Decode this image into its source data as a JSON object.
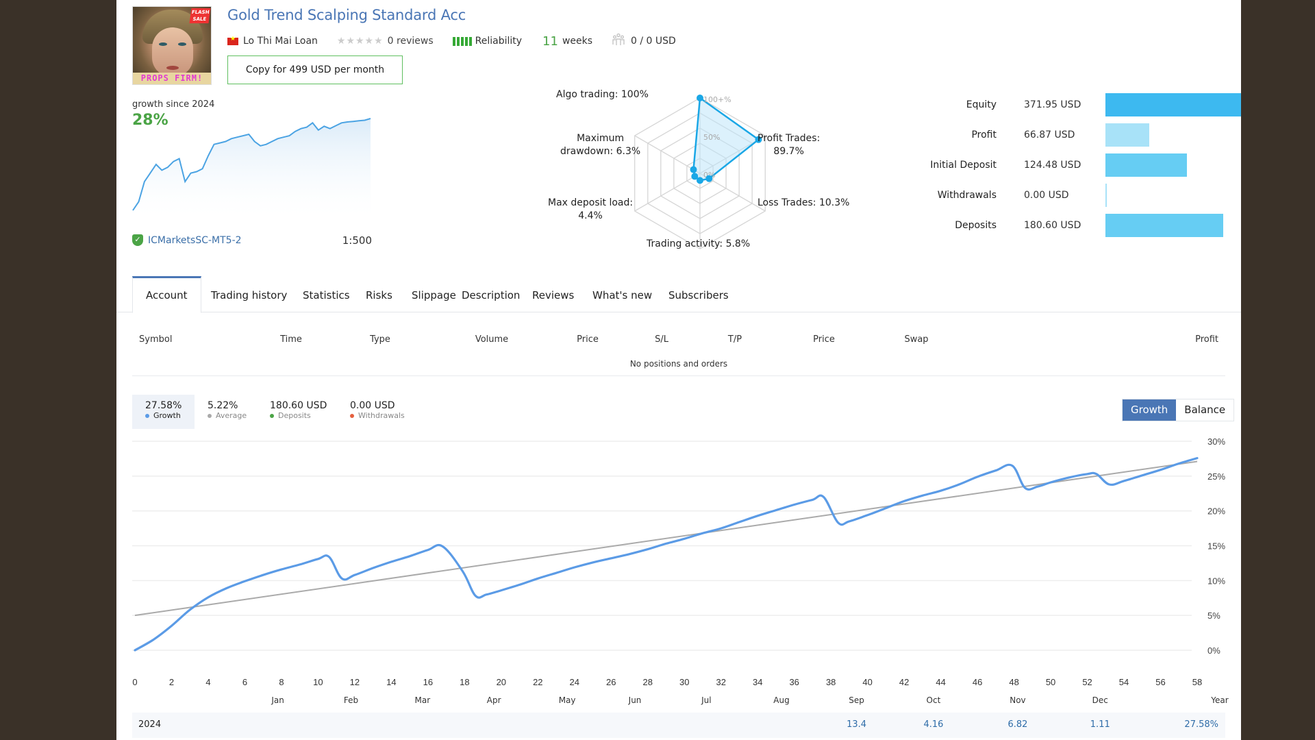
{
  "header": {
    "title": "Gold Trend Scalping Standard Acc",
    "avatar": {
      "banner_text": "PROPS FIRM!",
      "badge_text": "FLASH SALE"
    },
    "author": "Lo Thi Mai Loan",
    "author_flag_icon": "vietnam-flag-icon",
    "rating_stars": 0,
    "reviews": "0 reviews",
    "reliability_label": "Reliability",
    "reliability_bars": 5,
    "weeks_number": "11",
    "weeks_label": "weeks",
    "subscribers": "0 / 0 USD",
    "copy_button": "Copy for 499 USD per month"
  },
  "mini_growth": {
    "label": "growth since 2024",
    "value": "28%",
    "broker": "ICMarketsSC-MT5-2",
    "leverage": "1:500",
    "points": [
      0,
      3,
      10,
      13,
      16,
      14,
      15,
      17,
      18,
      10,
      13,
      13.5,
      14.5,
      19,
      23,
      23.5,
      24,
      25,
      25.5,
      26,
      26.5,
      24,
      22.5,
      23,
      24,
      25,
      25.5,
      26,
      27.5,
      28.5,
      29,
      30.5,
      28,
      29.3,
      28.5,
      29.5,
      30.5,
      30.8,
      31,
      31.2,
      31.4,
      32
    ]
  },
  "radar": {
    "axis_labels": [
      "100+%",
      "50%",
      "0%"
    ],
    "axes": [
      {
        "label": "Algo trading: 100%",
        "value": 100
      },
      {
        "label": "Profit Trades: 89.7%",
        "label_lines": [
          "Profit Trades:",
          "89.7%"
        ],
        "value": 89.7
      },
      {
        "label": "Loss Trades: 10.3%",
        "value": 10.3
      },
      {
        "label": "Trading activity: 5.8%",
        "value": 5.8
      },
      {
        "label": "Max deposit load: 4.4%",
        "label_lines": [
          "Max deposit load:",
          "4.4%"
        ],
        "value": 4.4
      },
      {
        "label": "Maximum drawdown: 6.3%",
        "label_lines": [
          "Maximum",
          "drawdown: 6.3%"
        ],
        "value": 6.3
      }
    ]
  },
  "financials": [
    {
      "label": "Equity",
      "value": "371.95 USD",
      "amount": 371.95,
      "color": "#3db9f0"
    },
    {
      "label": "Profit",
      "value": "66.87 USD",
      "amount": 66.87,
      "color": "#a8e2f8"
    },
    {
      "label": "Initial Deposit",
      "value": "124.48 USD",
      "amount": 124.48,
      "color": "#66cdf3"
    },
    {
      "label": "Withdrawals",
      "value": "0.00 USD",
      "amount": 0,
      "color": "#a8e2f8"
    },
    {
      "label": "Deposits",
      "value": "180.60 USD",
      "amount": 180.6,
      "color": "#66cdf3"
    }
  ],
  "tabs": [
    {
      "label": "Account",
      "active": true
    },
    {
      "label": "Trading history"
    },
    {
      "label": "Statistics"
    },
    {
      "label": "Risks"
    },
    {
      "label": "Slippage"
    },
    {
      "label": "Description"
    },
    {
      "label": "Reviews"
    },
    {
      "label": "What's new"
    },
    {
      "label": "Subscribers"
    }
  ],
  "positions": {
    "columns": [
      "Symbol",
      "Time",
      "Type",
      "Volume",
      "Price",
      "S/L",
      "T/P",
      "Price",
      "Swap",
      "Profit"
    ],
    "empty_text": "No positions and orders"
  },
  "summary": [
    {
      "value": "27.58%",
      "label": "Growth",
      "dot": "#5b9be6",
      "active": true
    },
    {
      "value": "5.22%",
      "label": "Average",
      "dot": "#aaaaaa"
    },
    {
      "value": "180.60 USD",
      "label": "Deposits",
      "dot": "#4ba446"
    },
    {
      "value": "0.00 USD",
      "label": "Withdrawals",
      "dot": "#e5603f"
    }
  ],
  "chart_toggle": {
    "growth": "Growth",
    "balance": "Balance",
    "active": "Growth"
  },
  "chart_data": {
    "type": "line",
    "title": "",
    "xlabel": "",
    "ylabel": "",
    "xlim": [
      0,
      58
    ],
    "ylim": [
      0,
      30
    ],
    "x_ticks": [
      0,
      2,
      4,
      6,
      8,
      10,
      12,
      14,
      16,
      18,
      20,
      22,
      24,
      26,
      28,
      30,
      32,
      34,
      36,
      38,
      40,
      42,
      44,
      46,
      48,
      50,
      52,
      54,
      56,
      58
    ],
    "y_ticks": [
      "0%",
      "5%",
      "10%",
      "15%",
      "20%",
      "25%",
      "30%"
    ],
    "y_tick_values": [
      0,
      5,
      10,
      15,
      20,
      25,
      30
    ],
    "grid": true,
    "series": [
      {
        "name": "Growth",
        "color": "#5b9be6",
        "x": [
          0,
          1,
          2,
          3,
          4,
          5,
          6,
          7,
          8,
          9,
          10,
          10.6,
          11.3,
          12,
          13,
          14,
          15,
          16,
          16.8,
          17.9,
          18.6,
          19.2,
          20,
          21,
          22,
          23,
          24,
          25,
          26,
          27,
          28,
          29,
          30,
          31,
          32,
          33,
          34,
          35,
          36,
          37,
          37.6,
          38.4,
          39,
          40,
          41,
          42,
          43,
          44,
          45,
          46,
          47,
          47.9,
          48.6,
          49.3,
          50,
          51,
          52,
          52.5,
          53.2,
          54,
          55,
          56,
          57,
          58
        ],
        "y": [
          0,
          1.5,
          3.5,
          5.8,
          7.6,
          8.9,
          9.9,
          10.8,
          11.6,
          12.3,
          13.1,
          13.4,
          10.3,
          10.8,
          11.8,
          12.7,
          13.5,
          14.4,
          14.9,
          11.3,
          7.8,
          8.0,
          8.6,
          9.4,
          10.3,
          11.1,
          11.9,
          12.6,
          13.2,
          13.8,
          14.5,
          15.3,
          16.0,
          16.8,
          17.5,
          18.4,
          19.3,
          20.1,
          20.9,
          21.6,
          22.0,
          18.3,
          18.5,
          19.4,
          20.4,
          21.4,
          22.2,
          22.9,
          23.8,
          24.9,
          25.8,
          26.5,
          23.3,
          23.5,
          24.1,
          24.8,
          25.3,
          25.3,
          23.8,
          24.3,
          25.1,
          25.9,
          26.8,
          27.58
        ]
      },
      {
        "name": "Average",
        "color": "#aaaaaa",
        "x": [
          0,
          58
        ],
        "y": [
          5.0,
          27.1
        ]
      }
    ],
    "months": [
      {
        "label": "Jan",
        "week": 7.8
      },
      {
        "label": "Feb",
        "week": 11.8
      },
      {
        "label": "Mar",
        "week": 15.7
      },
      {
        "label": "Apr",
        "week": 19.6
      },
      {
        "label": "May",
        "week": 23.6
      },
      {
        "label": "Jun",
        "week": 27.3
      },
      {
        "label": "Jul",
        "week": 31.2
      },
      {
        "label": "Aug",
        "week": 35.3
      },
      {
        "label": "Sep",
        "week": 39.4
      },
      {
        "label": "Oct",
        "week": 43.6
      },
      {
        "label": "Nov",
        "week": 48.2
      },
      {
        "label": "Dec",
        "week": 52.7
      }
    ],
    "year_label": "Year",
    "yearly_table": {
      "year": "2024",
      "months": {
        "Sep": "13.4",
        "Oct": "4.16",
        "Nov": "6.82",
        "Dec": "1.11"
      },
      "year_total": "27.58%"
    }
  }
}
